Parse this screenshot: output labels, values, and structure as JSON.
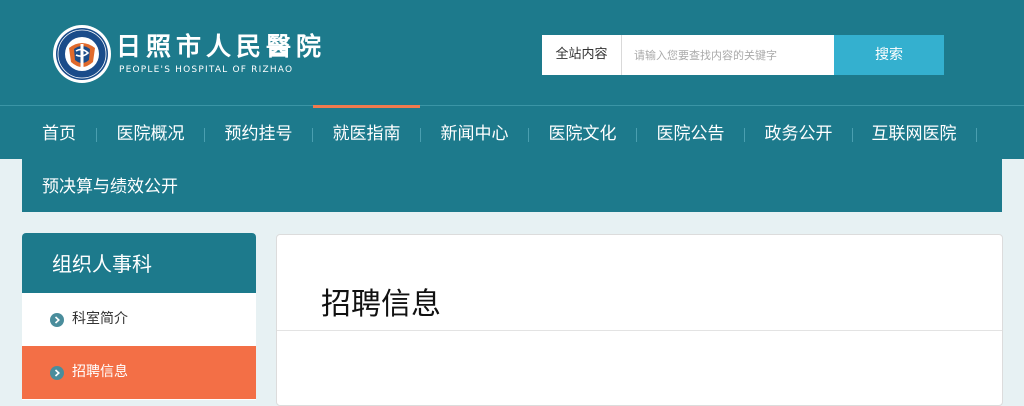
{
  "header": {
    "title": "日照市人民醫院",
    "subtitle": "PEOPLE'S HOSPITAL OF RIZHAO"
  },
  "search": {
    "scope_label": "全站内容",
    "placeholder": "请输入您要查找内容的关键字",
    "button_label": "搜索"
  },
  "nav": {
    "items": [
      {
        "label": "首页"
      },
      {
        "label": "医院概况"
      },
      {
        "label": "预约挂号"
      },
      {
        "label": "就医指南"
      },
      {
        "label": "新闻中心"
      },
      {
        "label": "医院文化"
      },
      {
        "label": "医院公告"
      },
      {
        "label": "政务公开"
      },
      {
        "label": "互联网医院"
      },
      {
        "label": "预决算与绩效公开"
      }
    ],
    "active": "就医指南"
  },
  "sidebar": {
    "title": "组织人事科",
    "items": [
      {
        "label": "科室简介"
      },
      {
        "label": "招聘信息"
      }
    ]
  },
  "main": {
    "title": "招聘信息"
  },
  "colors": {
    "primary": "#1d7a8c",
    "accent": "#f36f46",
    "search_button": "#34b0cf"
  },
  "icons": {
    "logo": "hospital-emblem",
    "side_item": "chevron-right-circle-icon"
  }
}
